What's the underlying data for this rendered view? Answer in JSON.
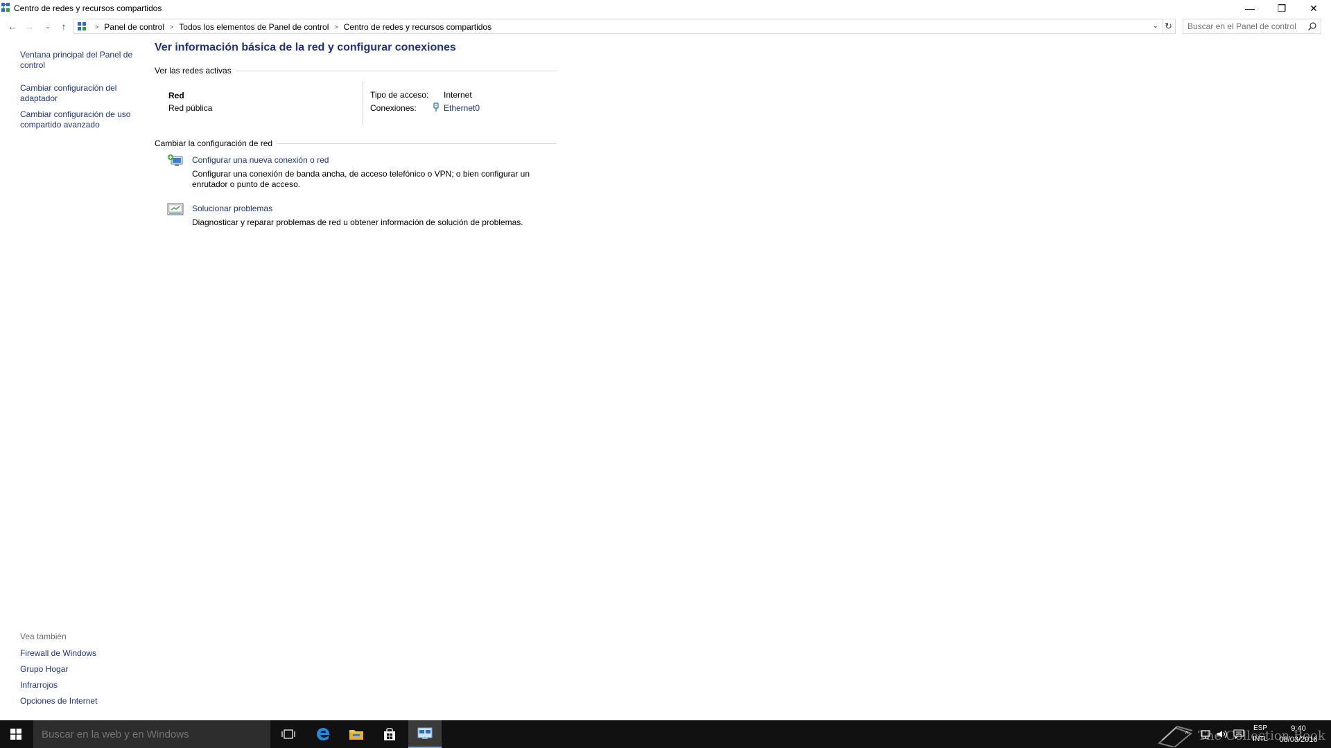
{
  "window": {
    "title": "Centro de redes y recursos compartidos",
    "minimize_glyph": "—",
    "maximize_glyph": "❐",
    "close_glyph": "✕"
  },
  "nav": {
    "back_glyph": "←",
    "forward_glyph": "→",
    "recent_glyph": "⌄",
    "up_glyph": "↑",
    "refresh_glyph": "↻",
    "dropdown_glyph": "⌄",
    "breadcrumbs": [
      "Panel de control",
      "Todos los elementos de Panel de control",
      "Centro de redes y recursos compartidos"
    ],
    "separator": ">"
  },
  "search": {
    "placeholder": "Buscar en el Panel de control"
  },
  "sidebar": {
    "links": [
      "Ventana principal del Panel de control",
      "Cambiar configuración del adaptador",
      "Cambiar configuración de uso compartido avanzado"
    ],
    "see_also_header": "Vea también",
    "see_also": [
      "Firewall de Windows",
      "Grupo Hogar",
      "Infrarrojos",
      "Opciones de Internet"
    ]
  },
  "main": {
    "heading": "Ver información básica de la red y configurar conexiones",
    "active_networks_label": "Ver las redes activas",
    "network": {
      "name": "Red",
      "type": "Red pública",
      "access_label": "Tipo de acceso:",
      "access_value": "Internet",
      "connections_label": "Conexiones:",
      "connection_name": "Ethernet0"
    },
    "change_settings_label": "Cambiar la configuración de red",
    "tasks": [
      {
        "title": "Configurar una nueva conexión o red",
        "description": "Configurar una conexión de banda ancha, de acceso telefónico o VPN; o bien configurar un enrutador o punto de acceso."
      },
      {
        "title": "Solucionar problemas",
        "description": "Diagnosticar y reparar problemas de red u obtener información de solución de problemas."
      }
    ]
  },
  "taskbar": {
    "search_placeholder": "Buscar en la web y en Windows",
    "tray_up_glyph": "^",
    "language_line1": "ESP",
    "language_line2": "INTL",
    "time": "9:40",
    "date": "08/03/2016",
    "watermark": "The Collection Book",
    "accent": "#78aee6"
  },
  "colors": {
    "link": "#1e3287",
    "heading": "#1e3287",
    "taskbar": "#111111"
  }
}
